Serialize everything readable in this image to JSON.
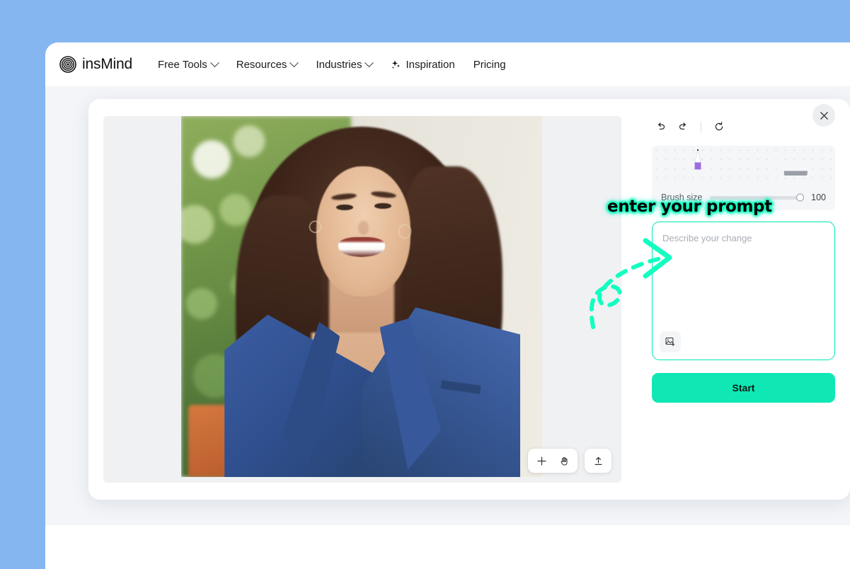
{
  "nav": {
    "logo_text": "insMind",
    "logo_icon": "concentric-circles-logo",
    "items": [
      {
        "label": "Free Tools",
        "caret": true,
        "icon": null
      },
      {
        "label": "Resources",
        "caret": true,
        "icon": null
      },
      {
        "label": "Industries",
        "caret": true,
        "icon": null
      },
      {
        "label": "Inspiration",
        "caret": false,
        "icon": "sparkle-icon"
      },
      {
        "label": "Pricing",
        "caret": false,
        "icon": null
      }
    ]
  },
  "editor": {
    "close_icon": "close-icon",
    "canvas": {
      "image_alt": "smiling woman with long brown wavy hair wearing a blue blazer outdoors",
      "tools": [
        {
          "name": "zoom-in-tool",
          "icon": "plus-icon"
        },
        {
          "name": "pan-tool",
          "icon": "hand-icon"
        },
        {
          "name": "upload-tool",
          "icon": "upload-icon"
        }
      ]
    },
    "history": [
      {
        "name": "undo-button",
        "icon": "undo-arrow-icon"
      },
      {
        "name": "redo-button",
        "icon": "redo-arrow-icon"
      },
      {
        "name": "reset-button",
        "icon": "refresh-icon"
      }
    ],
    "brush": {
      "label": "Brush size",
      "value": "100",
      "slider_percent": 100,
      "pen_color": "#9b6ee0",
      "tools": [
        "brush-tool",
        "eraser-tool"
      ]
    },
    "prompt": {
      "placeholder": "Describe your change",
      "value": "",
      "upload_icon": "image-upload-icon",
      "border_color": "#00e7b4"
    },
    "start_label": "Start",
    "start_color": "#0fe8b5"
  },
  "annotation": {
    "text": "enter your prompt",
    "color": "#12ffc0",
    "arrow": "dashed-curved-arrow"
  },
  "theme": {
    "page_background": "#85b6f0",
    "body_background": "#f3f5f8",
    "card_background": "#ffffff"
  }
}
